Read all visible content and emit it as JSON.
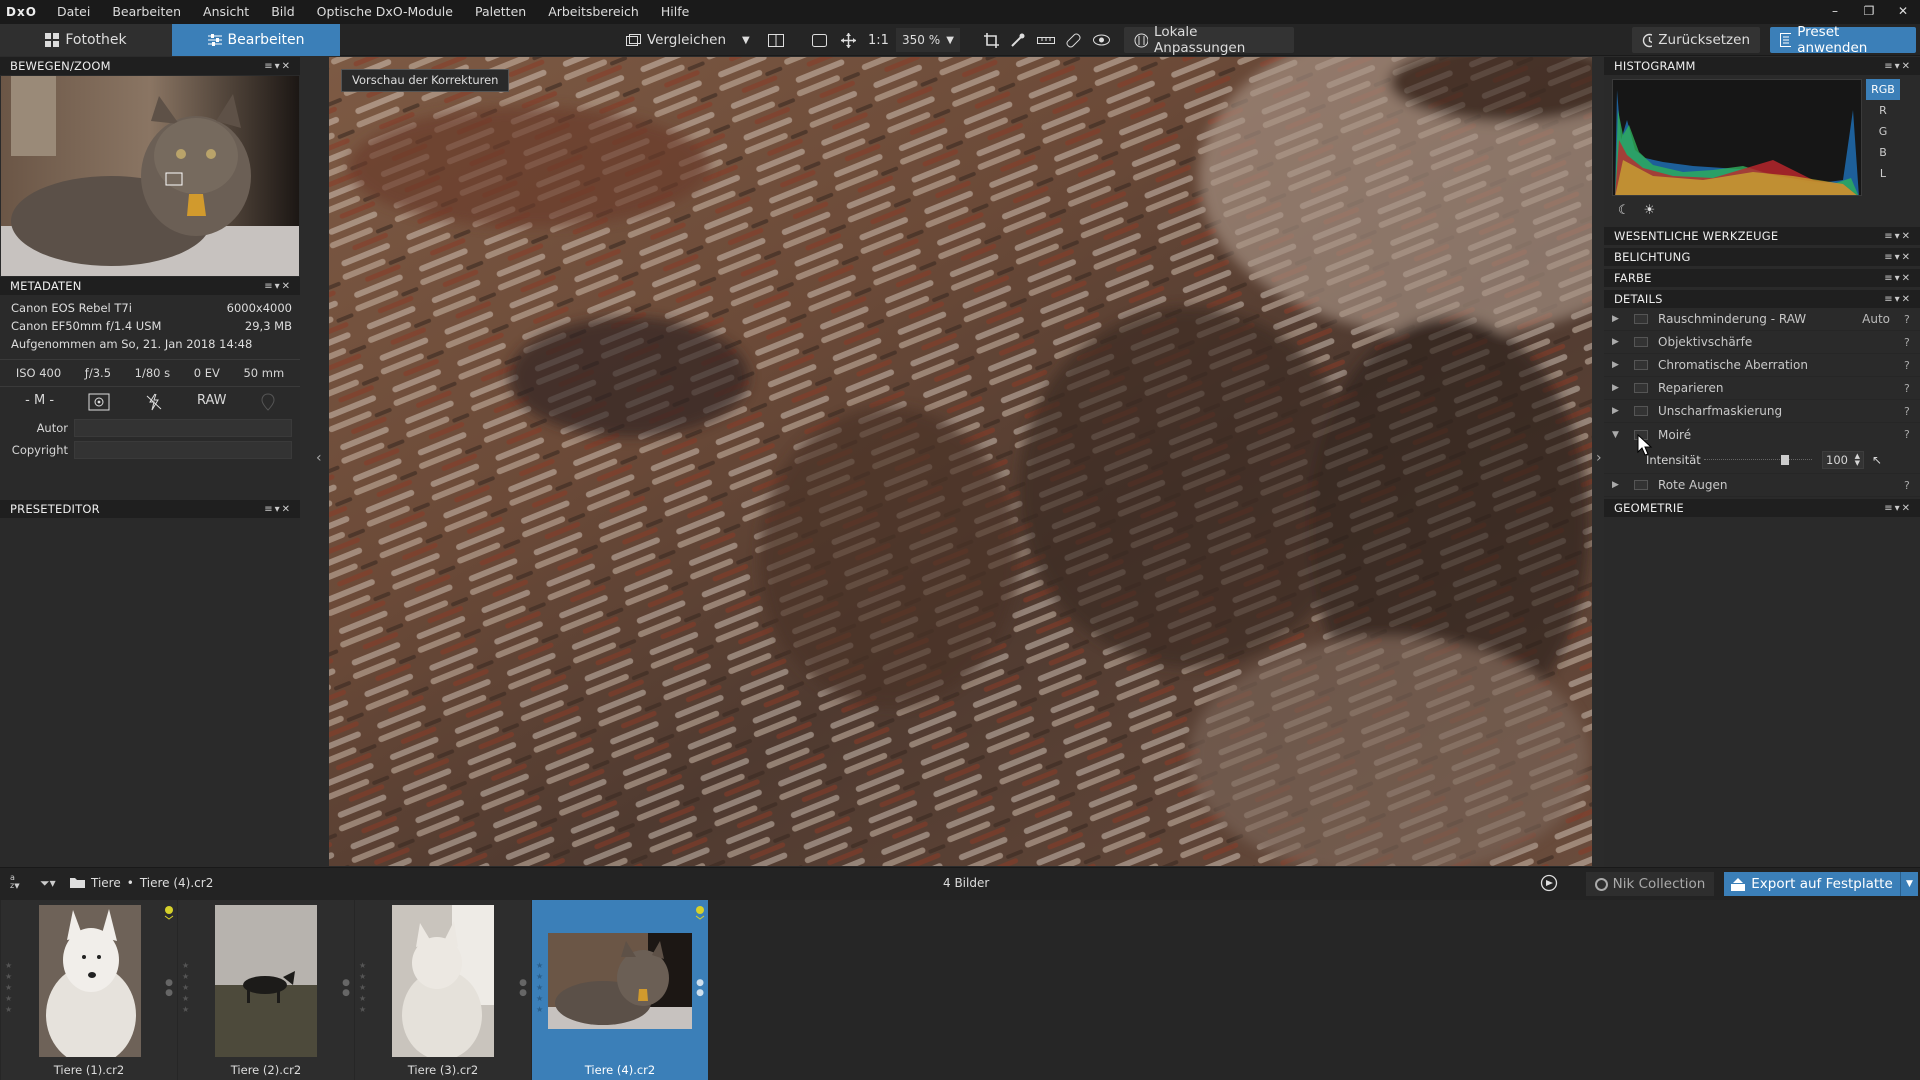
{
  "menubar": {
    "logo": "DxO",
    "items": [
      "Datei",
      "Bearbeiten",
      "Ansicht",
      "Bild",
      "Optische DxO-Module",
      "Paletten",
      "Arbeitsbereich",
      "Hilfe"
    ],
    "window_controls": [
      "–",
      "❐",
      "✕"
    ]
  },
  "toolbar": {
    "tab_fotothek": "Fotothek",
    "tab_bearbeiten": "Bearbeiten",
    "compare": "Vergleichen",
    "ratio": "1:1",
    "zoom": "350 %",
    "local_adjust": "Lokale Anpassungen",
    "reset": "Zurücksetzen",
    "preset": "Preset anwenden"
  },
  "left": {
    "move_zoom_title": "BEWEGEN/ZOOM",
    "metadata_title": "METADATEN",
    "camera": "Canon EOS Rebel T7i",
    "resolution": "6000x4000",
    "lens": "Canon EF50mm f/1.4 USM",
    "filesize": "29,3 MB",
    "taken": "Aufgenommen am So, 21. Jan 2018 14:48",
    "exif": [
      "ISO 400",
      "ƒ/3.5",
      "1/80 s",
      "0 EV",
      "50 mm"
    ],
    "mode": "- M -",
    "raw": "RAW",
    "author_label": "Autor",
    "copyright_label": "Copyright",
    "preseteditor_title": "PRESETEDITOR"
  },
  "viewer": {
    "preview_label": "Vorschau der Korrekturen"
  },
  "right": {
    "histogram_title": "HISTOGRAMM",
    "channels": [
      "RGB",
      "R",
      "G",
      "B",
      "L"
    ],
    "sections": [
      "WESENTLICHE WERKZEUGE",
      "BELICHTUNG",
      "FARBE",
      "DETAILS"
    ],
    "details": [
      {
        "name": "Rauschminderung - RAW",
        "value": "Auto"
      },
      {
        "name": "Objektivschärfe",
        "value": ""
      },
      {
        "name": "Chromatische Aberration",
        "value": ""
      },
      {
        "name": "Reparieren",
        "value": ""
      },
      {
        "name": "Unscharfmaskierung",
        "value": ""
      },
      {
        "name": "Moiré",
        "value": ""
      }
    ],
    "intensity_label": "Intensität",
    "intensity_value": "100",
    "intensity_fraction": 0.77,
    "red_eye": "Rote Augen",
    "geometry_title": "GEOMETRIE",
    "help": "?"
  },
  "filmstrip": {
    "breadcrumb_root": "Tiere",
    "breadcrumb_file": "Tiere (4).cr2",
    "count": "4 Bilder",
    "nik": "Nik Collection",
    "export": "Export auf Festplatte",
    "sort_top": "a",
    "sort_bottom": "z",
    "files": [
      "Tiere (1).cr2",
      "Tiere (2).cr2",
      "Tiere (3).cr2",
      "Tiere (4).cr2"
    ]
  },
  "colors": {
    "accent": "#3b7fb8",
    "panel": "#2a2a2a",
    "header": "#1f1f1f"
  }
}
